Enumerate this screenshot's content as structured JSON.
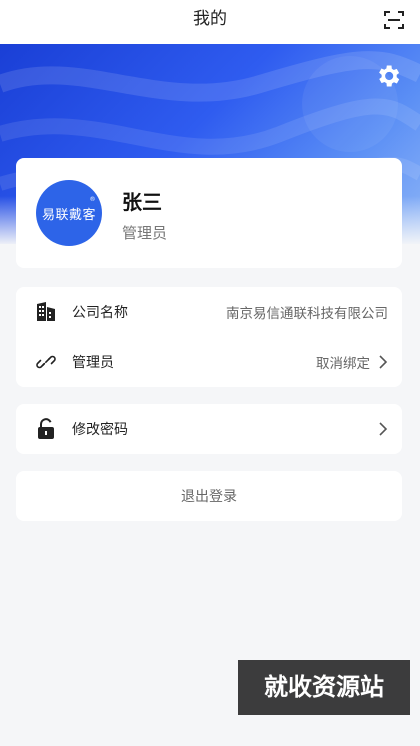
{
  "header": {
    "title": "我的",
    "scan_icon": "scan-icon"
  },
  "banner": {
    "settings_icon": "gear-icon",
    "accent": "#2f5cf0"
  },
  "profile": {
    "avatar_text": "易联戴客",
    "avatar_mark": "®",
    "name": "张三",
    "role": "管理员",
    "avatar_color": "#2d64e8"
  },
  "info": {
    "company_label": "公司名称",
    "company_value": "南京易信通联科技有限公司",
    "admin_label": "管理员",
    "admin_action": "取消绑定"
  },
  "security": {
    "change_password_label": "修改密码"
  },
  "logout": {
    "label": "退出登录"
  },
  "watermark": {
    "text": "就收资源站"
  }
}
